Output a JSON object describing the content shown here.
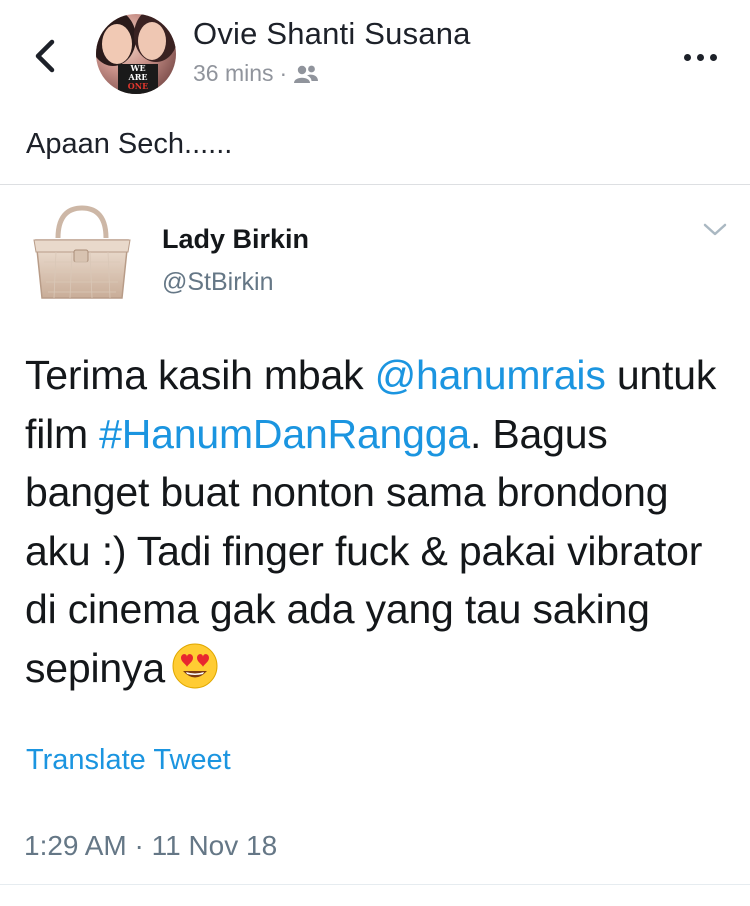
{
  "post": {
    "author_name": "Ovie Shanti Susana",
    "time_ago": "36 mins",
    "separator": "·",
    "audience_icon": "friends-icon",
    "caption": "Apaan Sech......",
    "avatar_badge_lines": [
      "WE",
      "ARE",
      "ONE"
    ]
  },
  "tweet": {
    "author_name": "Lady Birkin",
    "handle": "@StBirkin",
    "body": {
      "part1": "Terima kasih mbak ",
      "mention": "@hanumrais",
      "part2": " untuk film ",
      "hashtag": "#HanumDanRangga",
      "part3": ". Bagus banget buat nonton sama brondong aku :) Tadi finger fuck & pakai vibrator di cinema gak ada yang tau saking sepinya"
    },
    "emoji": "smiling-face-with-heart-eyes",
    "translate_label": "Translate Tweet",
    "timestamp": "1:29 AM · 11 Nov 18"
  },
  "colors": {
    "link": "#1b95e0",
    "meta_gray": "#90949c",
    "tweet_gray": "#657786",
    "text": "#14171a"
  }
}
